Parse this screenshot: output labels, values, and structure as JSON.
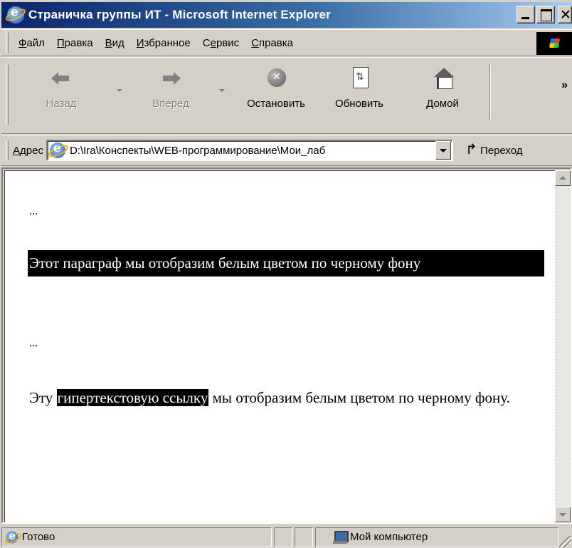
{
  "window": {
    "title": "Страничка группы ИТ - Microsoft Internet Explorer"
  },
  "menu": [
    {
      "first": "Ф",
      "rest": "айл"
    },
    {
      "first": "П",
      "rest": "равка"
    },
    {
      "first": "В",
      "rest": "ид"
    },
    {
      "first": "И",
      "rest": "збранное"
    },
    {
      "first": "С",
      "underline_pos": 1,
      "label": "Сервис"
    },
    {
      "first": "С",
      "rest": "правка"
    }
  ],
  "menu_labels": {
    "file_first": "Ф",
    "file_rest": "айл",
    "edit_first": "П",
    "edit_rest": "равка",
    "view_first": "В",
    "view_rest": "ид",
    "fav_first": "И",
    "fav_rest": "збранное",
    "tools_pre": "С",
    "tools_u": "е",
    "tools_rest": "рвис",
    "help_first": "С",
    "help_rest": "правка"
  },
  "toolbar": {
    "back": "Назад",
    "forward": "Вперед",
    "stop": "Остановить",
    "refresh": "Обновить",
    "home": "Домой",
    "more": "»"
  },
  "address": {
    "label_first": "А",
    "label_rest": "дрес",
    "value": "D:\\Ira\\Конспекты\\WEB-программирование\\Мои_лаб",
    "go": "Переход"
  },
  "content": {
    "ellipsis1": "...",
    "black_paragraph": "Этот параграф мы отобразим белым цветом по черному фону",
    "ellipsis2": "...",
    "link_before": "Эту ",
    "link_text": "гипертекстовую ссылку",
    "link_after": " мы отобразим белым цветом по черному фону."
  },
  "status": {
    "text": "Готово",
    "zone": "Мой компьютер"
  },
  "colors": {
    "title_start": "#0a246a",
    "title_end": "#a6caf0",
    "chrome": "#d4d0c8",
    "highlight_bg": "#000000",
    "highlight_fg": "#ffffff"
  }
}
